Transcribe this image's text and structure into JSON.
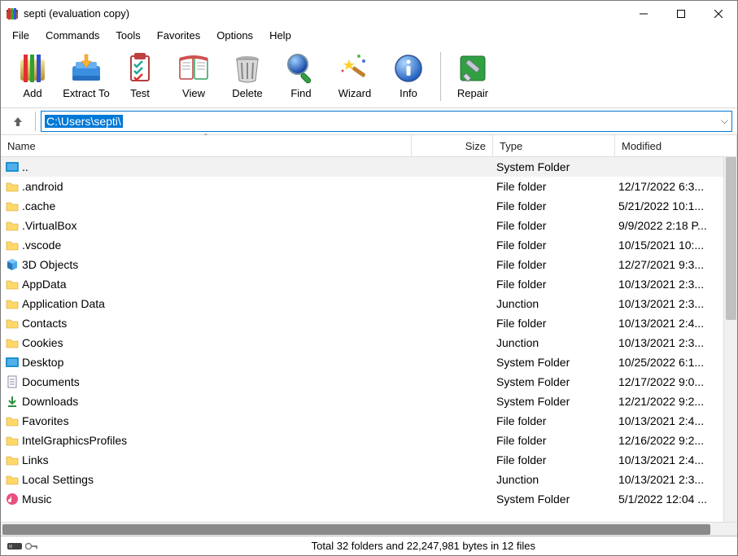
{
  "title": "septi (evaluation copy)",
  "menu": [
    "File",
    "Commands",
    "Tools",
    "Favorites",
    "Options",
    "Help"
  ],
  "toolbar": [
    {
      "id": "add",
      "label": "Add"
    },
    {
      "id": "extract",
      "label": "Extract To"
    },
    {
      "id": "test",
      "label": "Test"
    },
    {
      "id": "view",
      "label": "View"
    },
    {
      "id": "delete",
      "label": "Delete"
    },
    {
      "id": "find",
      "label": "Find"
    },
    {
      "id": "wizard",
      "label": "Wizard"
    },
    {
      "id": "info",
      "label": "Info"
    },
    {
      "id": "repair",
      "label": "Repair"
    }
  ],
  "path": "C:\\Users\\septi\\",
  "headers": {
    "name": "Name",
    "size": "Size",
    "type": "Type",
    "modified": "Modified"
  },
  "rows": [
    {
      "icon": "up",
      "name": "..",
      "type": "System Folder",
      "mod": "",
      "hover": true
    },
    {
      "icon": "folder",
      "name": ".android",
      "type": "File folder",
      "mod": "12/17/2022 6:3..."
    },
    {
      "icon": "folder",
      "name": ".cache",
      "type": "File folder",
      "mod": "5/21/2022 10:1..."
    },
    {
      "icon": "folder",
      "name": ".VirtualBox",
      "type": "File folder",
      "mod": "9/9/2022 2:18 P..."
    },
    {
      "icon": "folder",
      "name": ".vscode",
      "type": "File folder",
      "mod": "10/15/2021 10:..."
    },
    {
      "icon": "obj3d",
      "name": "3D Objects",
      "type": "File folder",
      "mod": "12/27/2021 9:3..."
    },
    {
      "icon": "folder",
      "name": "AppData",
      "type": "File folder",
      "mod": "10/13/2021 2:3..."
    },
    {
      "icon": "folder",
      "name": "Application Data",
      "type": "Junction",
      "mod": "10/13/2021 2:3..."
    },
    {
      "icon": "folder",
      "name": "Contacts",
      "type": "File folder",
      "mod": "10/13/2021 2:4..."
    },
    {
      "icon": "folder",
      "name": "Cookies",
      "type": "Junction",
      "mod": "10/13/2021 2:3..."
    },
    {
      "icon": "desktop",
      "name": "Desktop",
      "type": "System Folder",
      "mod": "10/25/2022 6:1..."
    },
    {
      "icon": "doc",
      "name": "Documents",
      "type": "System Folder",
      "mod": "12/17/2022 9:0..."
    },
    {
      "icon": "download",
      "name": "Downloads",
      "type": "System Folder",
      "mod": "12/21/2022 9:2..."
    },
    {
      "icon": "folder",
      "name": "Favorites",
      "type": "File folder",
      "mod": "10/13/2021 2:4..."
    },
    {
      "icon": "folder",
      "name": "IntelGraphicsProfiles",
      "type": "File folder",
      "mod": "12/16/2022 9:2..."
    },
    {
      "icon": "folder",
      "name": "Links",
      "type": "File folder",
      "mod": "10/13/2021 2:4..."
    },
    {
      "icon": "folder",
      "name": "Local Settings",
      "type": "Junction",
      "mod": "10/13/2021 2:3..."
    },
    {
      "icon": "music",
      "name": "Music",
      "type": "System Folder",
      "mod": "5/1/2022 12:04 ..."
    }
  ],
  "status": "Total 32 folders and 22,247,981 bytes in 12 files"
}
